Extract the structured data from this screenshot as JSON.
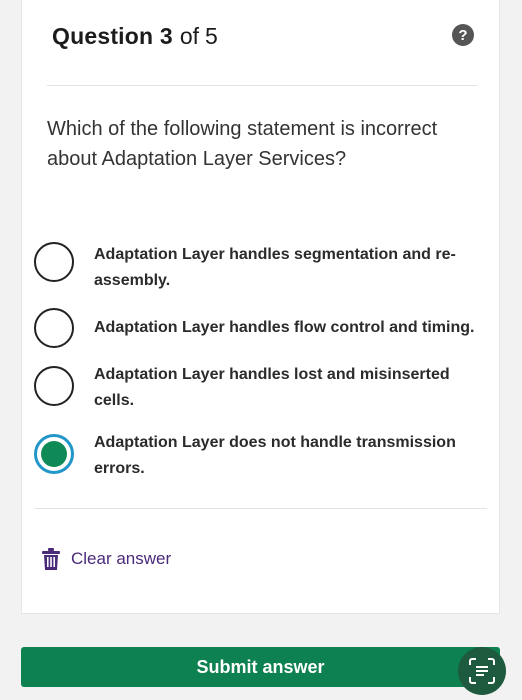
{
  "header": {
    "question_label": "Question 3",
    "of_word": "of",
    "total": "5",
    "help_icon": "question-circle-icon"
  },
  "question": {
    "text": "Which of the following statement is incorrect about Adaptation Layer Services?"
  },
  "options": [
    {
      "text": "Adaptation Layer handles segmentation and re-assembly.",
      "selected": false
    },
    {
      "text": "Adaptation Layer handles flow control and timing.",
      "selected": false
    },
    {
      "text": "Adaptation Layer handles lost and misinserted cells.",
      "selected": false
    },
    {
      "text": "Adaptation Layer does not handle transmission errors.",
      "selected": true
    }
  ],
  "clear": {
    "label": "Clear answer",
    "icon": "trash-icon"
  },
  "submit": {
    "label": "Submit answer"
  },
  "floating": {
    "icon": "scan-text-icon"
  },
  "colors": {
    "accent_green": "#0e8150",
    "selected_ring": "#2196c9",
    "selected_fill": "#0f8a57",
    "clear_purple": "#4a2a79"
  }
}
